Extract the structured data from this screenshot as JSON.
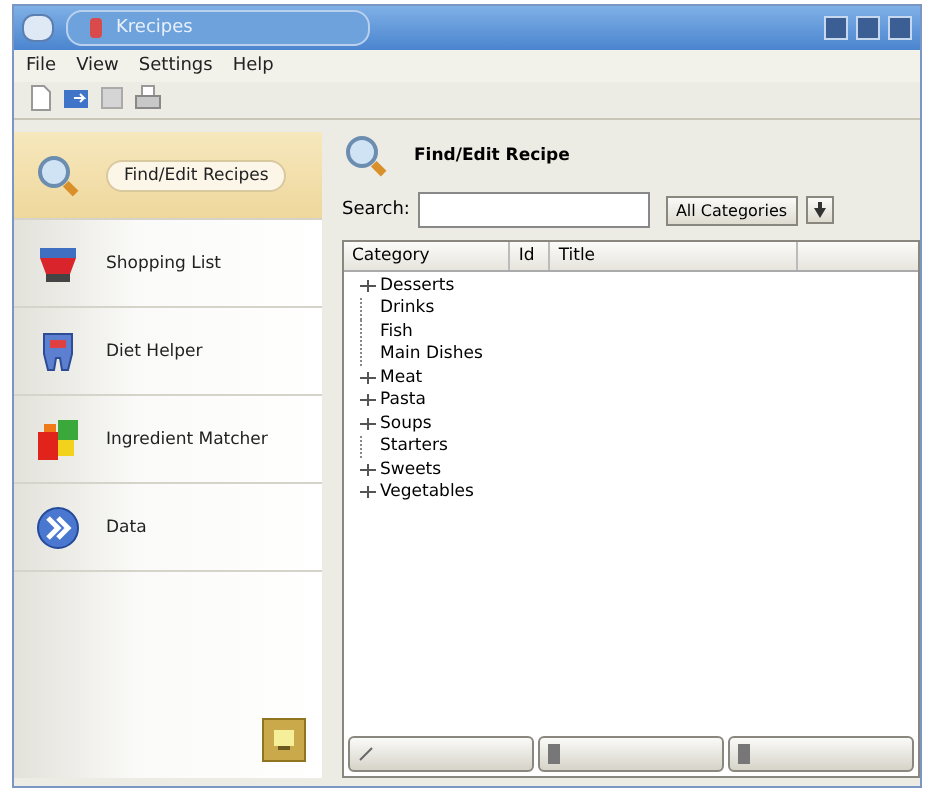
{
  "window": {
    "title": "Krecipes"
  },
  "menu": [
    "File",
    "View",
    "Settings",
    "Help"
  ],
  "sidebar": {
    "items": [
      {
        "label": "Find/Edit Recipes",
        "selected": true
      },
      {
        "label": "Shopping List",
        "selected": false
      },
      {
        "label": "Diet Helper",
        "selected": false
      },
      {
        "label": "Ingredient Matcher",
        "selected": false
      },
      {
        "label": "Data",
        "selected": false
      }
    ]
  },
  "panel": {
    "title": "Find/Edit Recipe",
    "search_label": "Search:",
    "category_button": "All Categories",
    "table": {
      "columns": [
        "Category",
        "Id",
        "Title"
      ],
      "rows": [
        {
          "label": "Desserts",
          "expandable": true
        },
        {
          "label": "Drinks",
          "expandable": false
        },
        {
          "label": "Fish",
          "expandable": false
        },
        {
          "label": "Main Dishes",
          "expandable": false
        },
        {
          "label": "Meat",
          "expandable": true
        },
        {
          "label": "Pasta",
          "expandable": true
        },
        {
          "label": "Soups",
          "expandable": true
        },
        {
          "label": "Starters",
          "expandable": false
        },
        {
          "label": "Sweets",
          "expandable": true
        },
        {
          "label": "Vegetables",
          "expandable": true
        }
      ]
    }
  }
}
